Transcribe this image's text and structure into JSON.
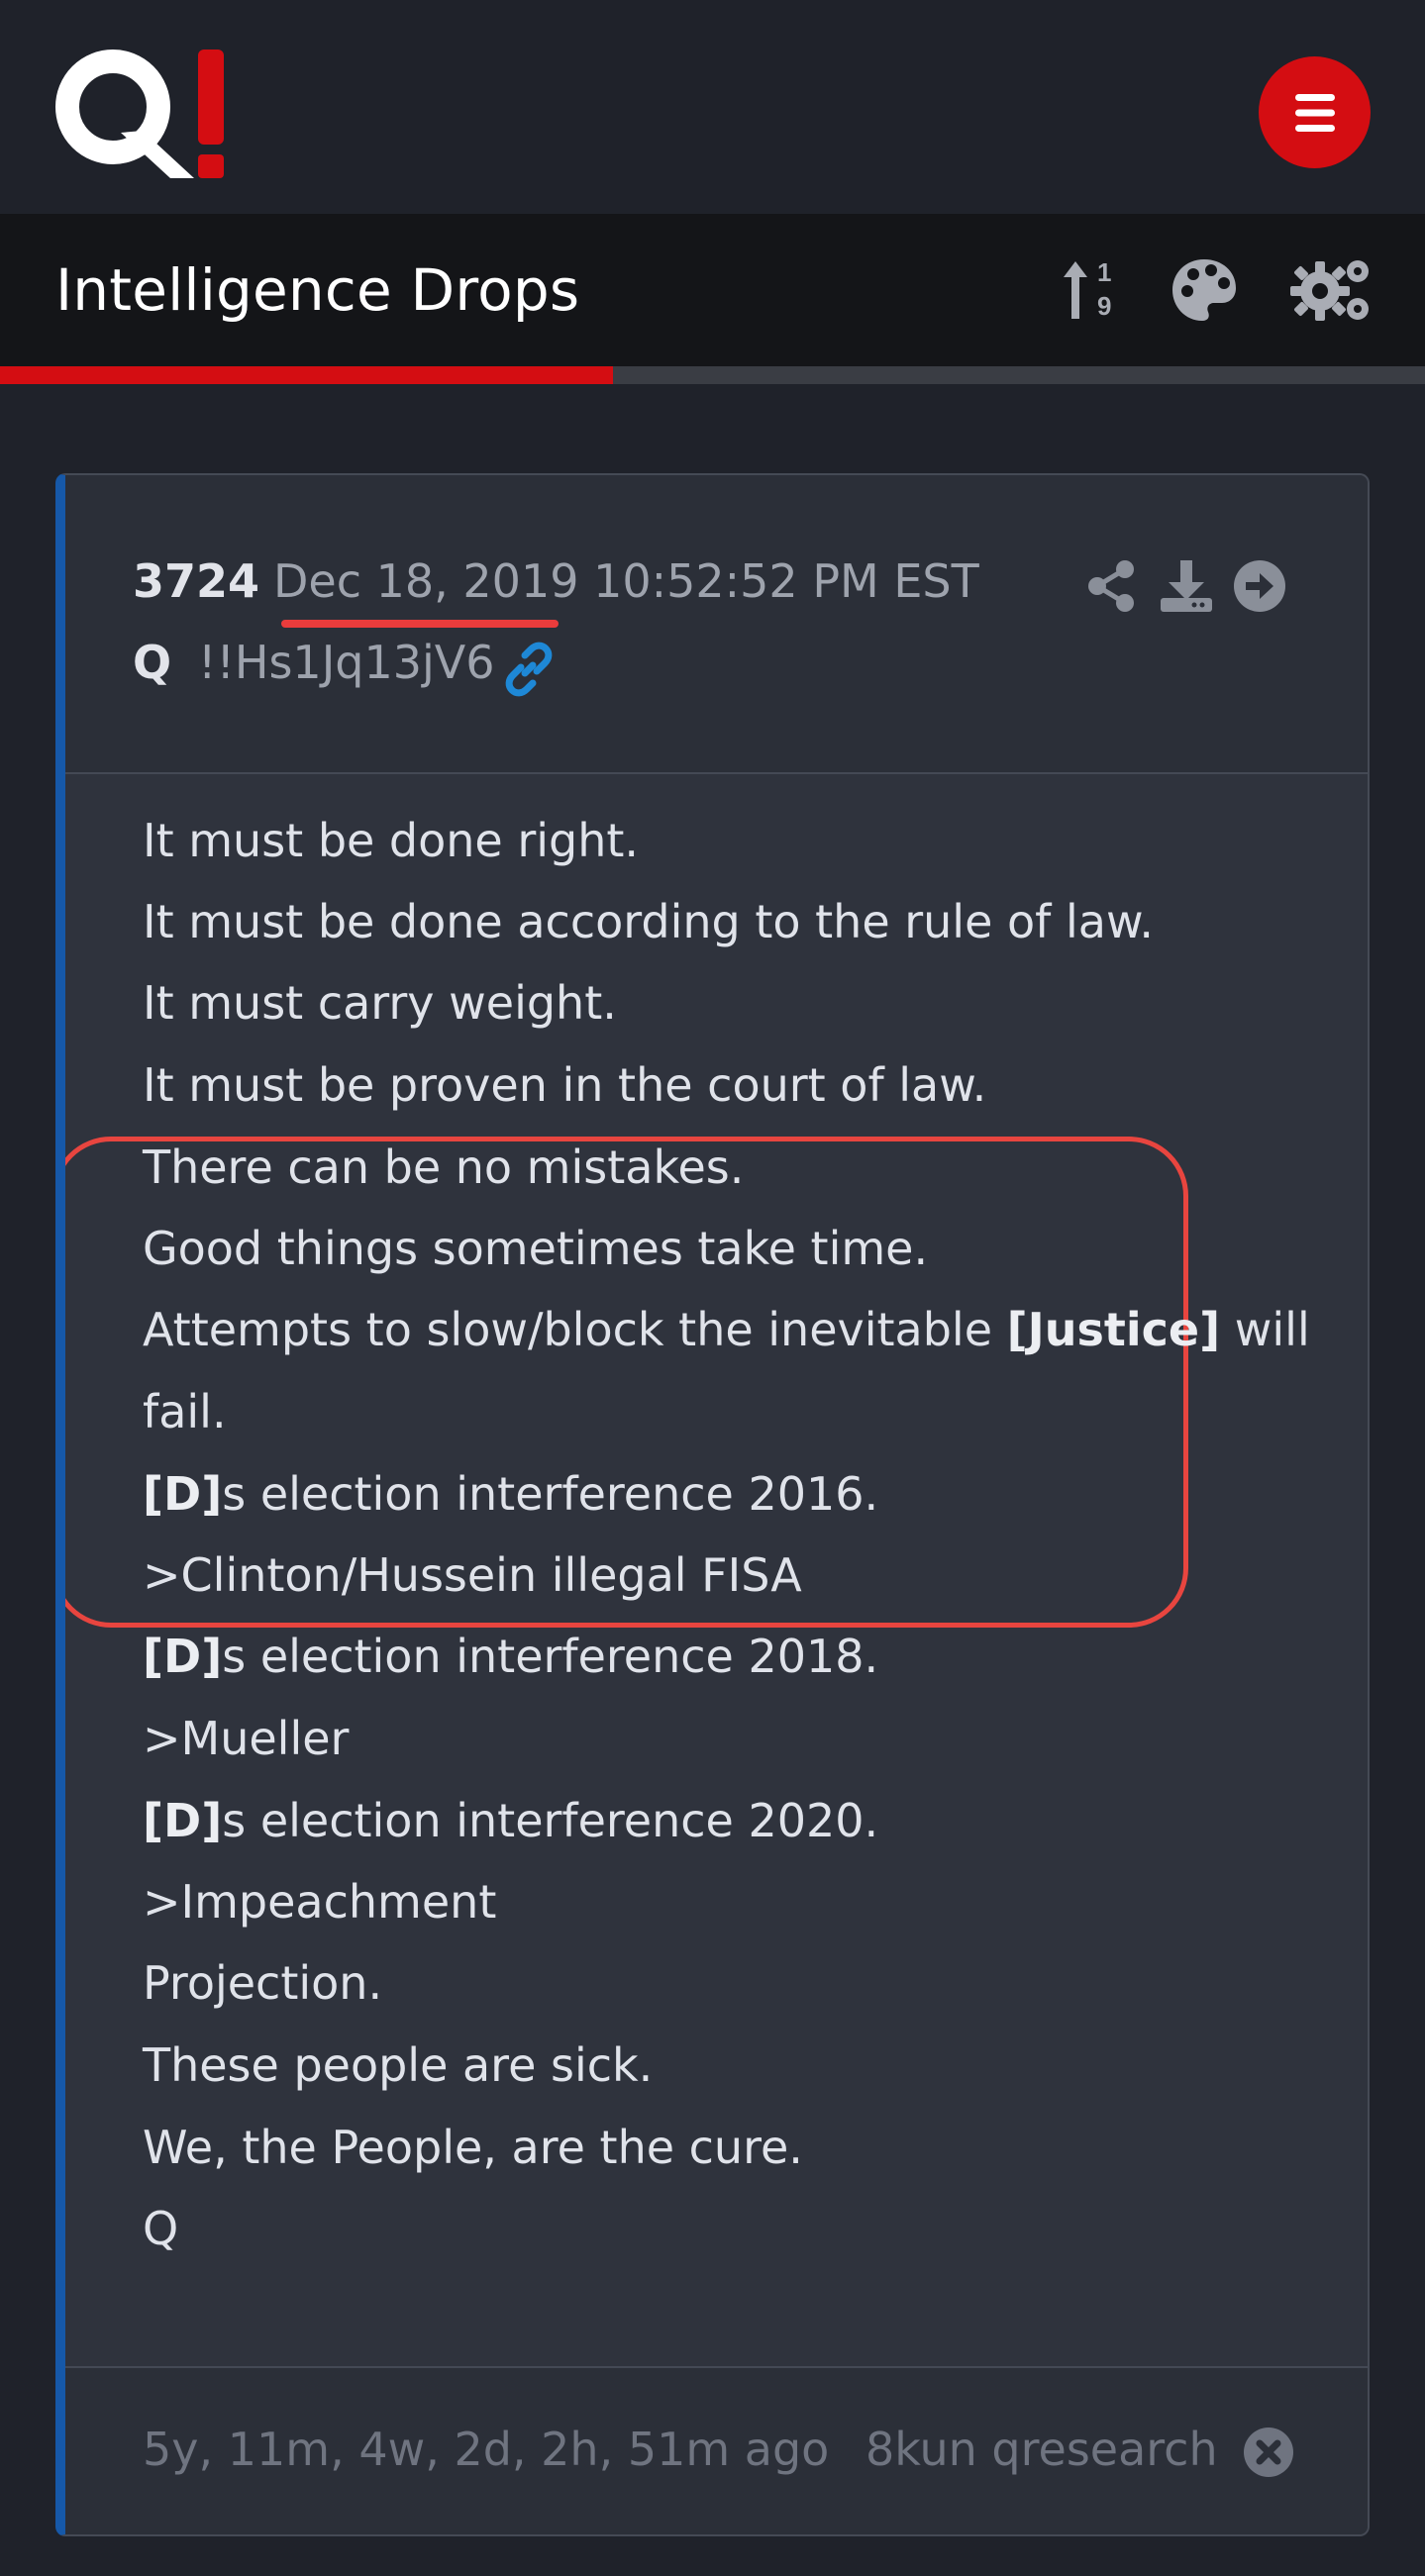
{
  "brand": {
    "logo_text": "Q!",
    "accent": "#d40d12",
    "logo_letter": "Q",
    "logo_mark": "!"
  },
  "header": {
    "menu_icon": "hamburger-menu-icon",
    "title": "Intelligence Drops",
    "sort_icon": "sort-numeric-icon",
    "theme_icon": "palette-icon",
    "settings_icon": "gears-icon",
    "read_progress": 0.43
  },
  "post": {
    "number": "3724",
    "date": "Dec 18, 2019 10:52:52 PM EST",
    "author": "Q",
    "tripcode": "!!Hs1Jq13jV6",
    "actions": [
      "share-icon",
      "download-icon",
      "next-arrow-icon"
    ],
    "lines": [
      "It must be done right.",
      "It must be done according to the rule of law.",
      "It must carry weight.",
      "It must be proven in the court of law.",
      "There can be no mistakes.",
      "Good things sometimes take time.",
      "Attempts to slow/block the inevitable ",
      "[Justice]",
      " will",
      "fail.",
      "[D]",
      "s election interference 2016.",
      ">Clinton/Hussein illegal FISA",
      "[D]",
      "s election interference 2018.",
      ">Mueller",
      "[D]",
      "s election interference 2020.",
      ">Impeachment",
      "Projection.",
      "These people are sick.",
      "We, the People, are the cure.",
      "Q"
    ],
    "elapsed": "5y, 11m, 4w, 2d, 2h, 51m ago",
    "source": "8kun qresearch"
  },
  "colors": {
    "background": "#1f222a",
    "card": "#2f333d",
    "card_border_accent": "#1658a8",
    "highlight": "#e8453f",
    "link": "#1e88d6"
  }
}
